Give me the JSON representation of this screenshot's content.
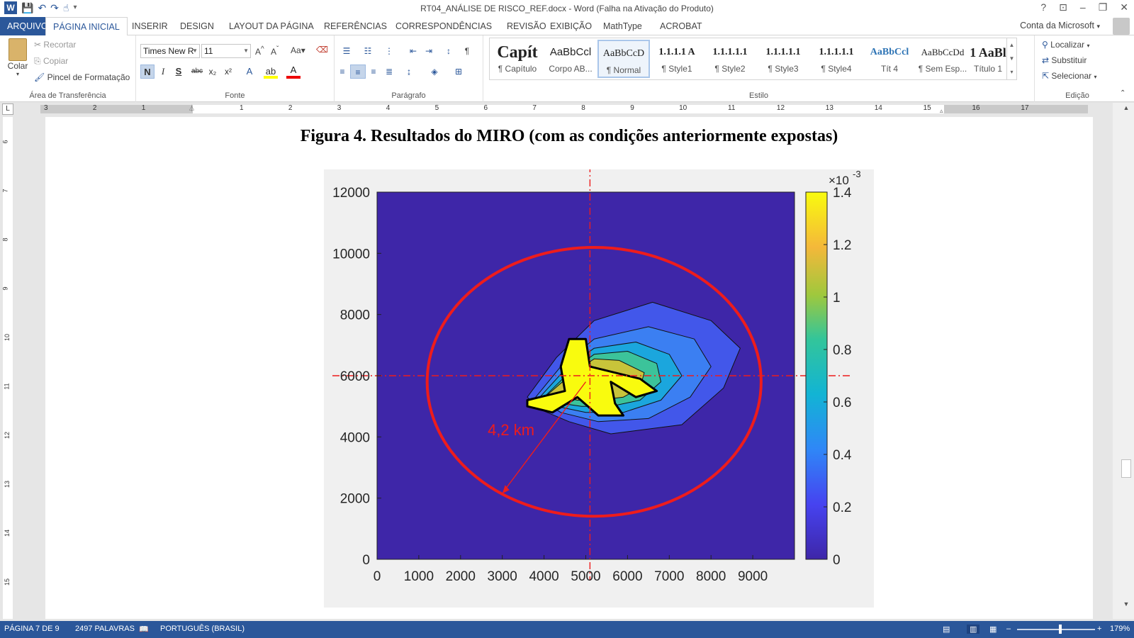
{
  "titlebar": {
    "title": "RT04_ANÁLISE DE RISCO_REF.docx - Word (Falha na Ativação do Produto)",
    "help": "?",
    "minimize": "–",
    "restore": "❐",
    "close": "✕"
  },
  "tabs": {
    "file": "ARQUIVO",
    "items": [
      "PÁGINA INICIAL",
      "INSERIR",
      "DESIGN",
      "LAYOUT DA PÁGINA",
      "REFERÊNCIAS",
      "CORRESPONDÊNCIAS",
      "REVISÃO",
      "EXIBIÇÃO",
      "MathType",
      "ACROBAT"
    ],
    "account": "Conta da Microsoft"
  },
  "clipboard": {
    "paste": "Colar",
    "cut": "Recortar",
    "copy": "Copiar",
    "painter": "Pincel de Formatação",
    "label": "Área de Transferência"
  },
  "font": {
    "name": "Times New R",
    "size": "11",
    "label": "Fonte",
    "bold": "N",
    "italic": "I",
    "underline": "S",
    "strike": "abc",
    "sub": "x₂",
    "sup": "x²",
    "case": "Aa"
  },
  "paragraph": {
    "label": "Parágrafo"
  },
  "styles": {
    "label": "Estilo",
    "items": [
      {
        "sample": "Capít",
        "name": "¶ Capítulo"
      },
      {
        "sample": "AaBbCcl",
        "name": "Corpo AB..."
      },
      {
        "sample": "AaBbCcD",
        "name": "¶ Normal"
      },
      {
        "sample": "1.1.1.1 A",
        "name": "¶ Style1"
      },
      {
        "sample": "1.1.1.1.1",
        "name": "¶ Style2"
      },
      {
        "sample": "1.1.1.1.1",
        "name": "¶ Style3"
      },
      {
        "sample": "1.1.1.1.1",
        "name": "¶ Style4"
      },
      {
        "sample": "AaBbCcl",
        "name": "Tít 4"
      },
      {
        "sample": "AaBbCcDd",
        "name": "¶ Sem Esp..."
      },
      {
        "sample": "1 AaBl",
        "name": "Título 1"
      }
    ]
  },
  "editing": {
    "label": "Edição",
    "find": "Localizar",
    "replace": "Substituir",
    "select": "Selecionar"
  },
  "ruler": {
    "h_numbers": [
      "3",
      "2",
      "1",
      "1",
      "2",
      "3",
      "4",
      "5",
      "6",
      "7",
      "8",
      "9",
      "10",
      "11",
      "12",
      "13",
      "14",
      "15",
      "16",
      "17"
    ],
    "v_numbers": [
      "6",
      "7",
      "8",
      "9",
      "10",
      "11",
      "12",
      "13",
      "14",
      "15"
    ],
    "corner": "L"
  },
  "document": {
    "caption": "Figura 4. Resultados do MIRO (com as condições anteriormente expostas)",
    "annotation": "4,2 km"
  },
  "chart_data": {
    "type": "heatmap",
    "title": "",
    "xlabel": "",
    "ylabel": "",
    "xlim": [
      0,
      10000
    ],
    "ylim": [
      0,
      12000
    ],
    "x_ticks": [
      "0",
      "1000",
      "2000",
      "3000",
      "4000",
      "5000",
      "6000",
      "7000",
      "8000",
      "9000"
    ],
    "y_ticks": [
      "0",
      "2000",
      "4000",
      "6000",
      "8000",
      "10000",
      "12000"
    ],
    "colorbar": {
      "exponent_label": "×10",
      "exponent": "-3",
      "ticks": [
        "0",
        "0.2",
        "0.4",
        "0.6",
        "0.8",
        "1",
        "1.2",
        "1.4"
      ],
      "range": [
        0,
        1.4
      ]
    },
    "colors": {
      "background": "#3e26a8",
      "low": "#4a5ae8",
      "mid": "#15b2d2",
      "yellow": "#f9fb0e",
      "circle": "#ee1c1c"
    }
  },
  "statusbar": {
    "page": "PÁGINA 7 DE 9",
    "words": "2497 PALAVRAS",
    "language": "PORTUGUÊS (BRASIL)",
    "zoom": "179%"
  }
}
